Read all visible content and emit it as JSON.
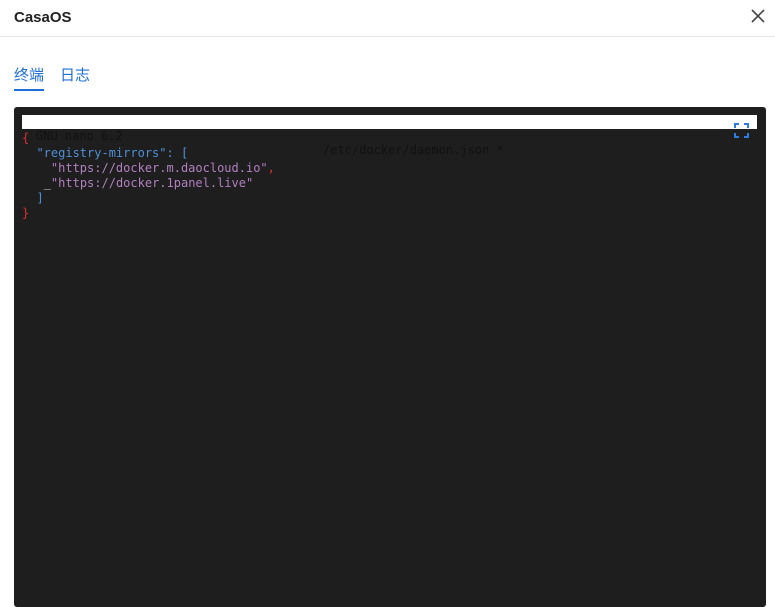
{
  "window": {
    "title": "CasaOS"
  },
  "tabs": [
    {
      "label": "终端",
      "active": true
    },
    {
      "label": "日志",
      "active": false
    }
  ],
  "terminal": {
    "nano_version": "GNU nano 6.2",
    "file_name": "/etc/docker/daemon.json *",
    "lines": {
      "l1": "{",
      "l2_key": "\"registry-mirrors\"",
      "l2_rest": ": [",
      "l3_val": "\"https://docker.m.daocloud.io\"",
      "l3_comma": ",",
      "l4_cursor": "_",
      "l4_val": "\"https://docker.1panel.live\"",
      "l5": "]",
      "l6": "}"
    }
  },
  "colors": {
    "accent": "#1e6fd9",
    "terminal_bg": "#1e1e1e"
  }
}
